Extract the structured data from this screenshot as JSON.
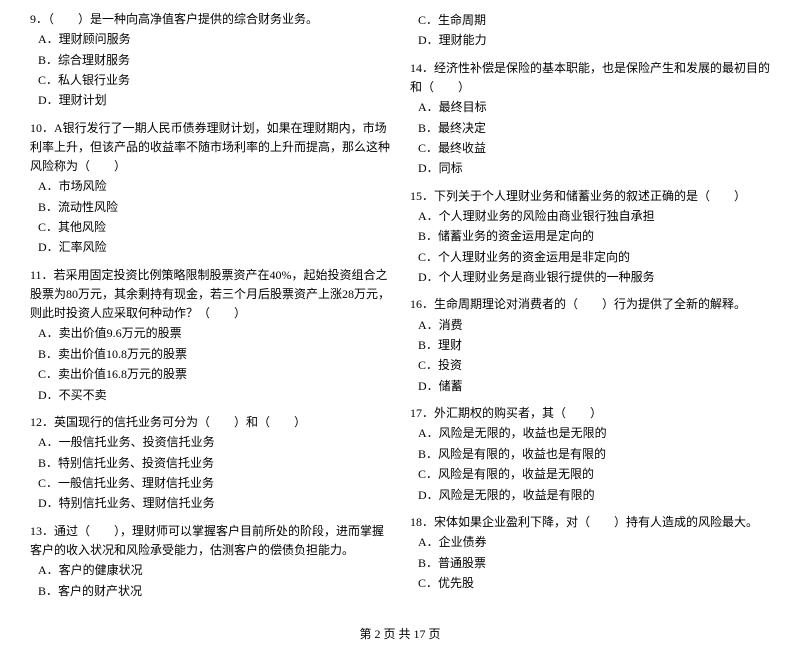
{
  "left_column": [
    {
      "id": "q9",
      "title": "9．（　　）是一种向高净值客户提供的综合财务业务。",
      "options": [
        "A．理财顾问服务",
        "B．综合理财服务",
        "C．私人银行业务",
        "D．理财计划"
      ]
    },
    {
      "id": "q10",
      "title": "10．A银行发行了一期人民币债券理财计划，如果在理财期内，市场利率上升，但该产品的收益率不随市场利率的上升而提高，那么这种风险称为（　　）",
      "options": [
        "A．市场风险",
        "B．流动性风险",
        "C．其他风险",
        "D．汇率风险"
      ]
    },
    {
      "id": "q11",
      "title": "11．若采用固定投资比例策略限制股票资产在40%，起始投资组合之股票为80万元，其余剩持有现金，若三个月后股票资产上涨28万元，则此时投资人应采取何种动作？（　　）",
      "options": [
        "A．卖出价值9.6万元的股票",
        "B．卖出价值10.8万元的股票",
        "C．卖出价值16.8万元的股票",
        "D．不买不卖"
      ]
    },
    {
      "id": "q12",
      "title": "12．英国现行的信托业务可分为（　　）和（　　）",
      "options": [
        "A．一般信托业务、投资信托业务",
        "B．特别信托业务、投资信托业务",
        "C．一般信托业务、理财信托业务",
        "D．特别信托业务、理财信托业务"
      ]
    },
    {
      "id": "q13",
      "title": "13．通过（　　），理财师可以掌握客户目前所处的阶段，进而掌握客户的收入状况和风险承受能力，估测客户的偿债负担能力。",
      "options": [
        "A．客户的健康状况",
        "B．客户的财产状况"
      ]
    }
  ],
  "right_column": [
    {
      "id": "q13c",
      "title": "",
      "options": [
        "C．生命周期",
        "D．理财能力"
      ]
    },
    {
      "id": "q14",
      "title": "14．经济性补偿是保险的基本职能，也是保险产生和发展的最初目的和（　　）",
      "options": [
        "A．最终目标",
        "B．最终决定",
        "C．最终收益",
        "D．同标"
      ]
    },
    {
      "id": "q15",
      "title": "15．下列关于个人理财业务和储蓄业务的叙述正确的是（　　）",
      "options": [
        "A．个人理财业务的风险由商业银行独自承担",
        "B．储蓄业务的资金运用是定向的",
        "C．个人理财业务的资金运用是非定向的",
        "D．个人理财业务是商业银行提供的一种服务"
      ]
    },
    {
      "id": "q16",
      "title": "16．生命周期理论对消费者的（　　）行为提供了全新的解释。",
      "options": [
        "A．消费",
        "B．理财",
        "C．投资",
        "D．储蓄"
      ]
    },
    {
      "id": "q17",
      "title": "17．外汇期权的购买者，其（　　）",
      "options": [
        "A．风险是无限的，收益也是无限的",
        "B．风险是有限的，收益也是有限的",
        "C．风险是有限的，收益是无限的",
        "D．风险是无限的，收益是有限的"
      ]
    },
    {
      "id": "q18",
      "title": "18．宋体如果企业盈利下降，对（　　）持有人造成的风险最大。",
      "options": [
        "A．企业债券",
        "B．普通股票",
        "C．优先股"
      ]
    }
  ],
  "footer": "第 2 页  共 17 页"
}
